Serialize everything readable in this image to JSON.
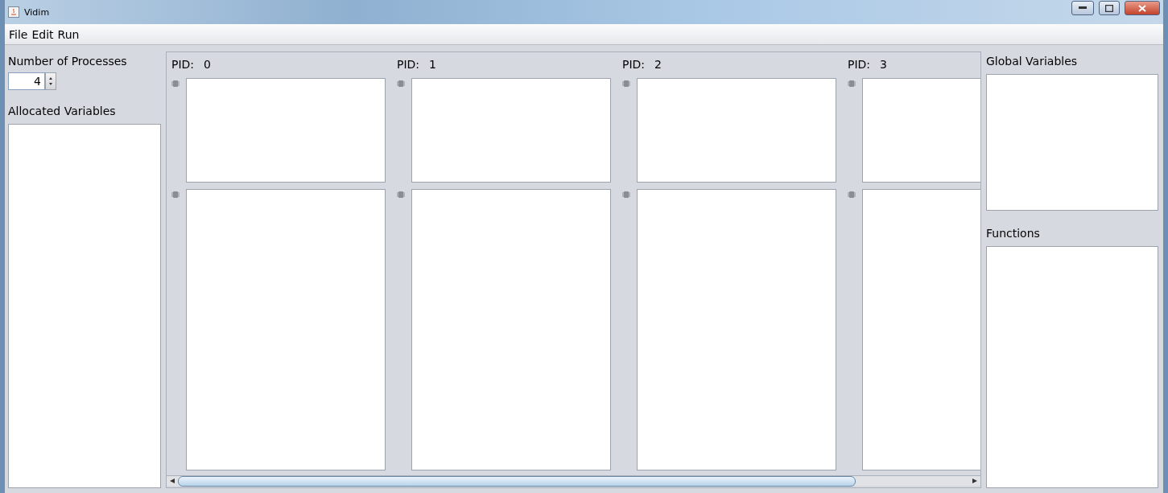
{
  "window": {
    "title": "Vidim"
  },
  "menu": [
    "File",
    "Edit",
    "Run"
  ],
  "left_panel": {
    "processes_label": "Number of Processes",
    "processes_value": "4",
    "allocated_label": "Allocated Variables"
  },
  "processes": [
    {
      "label": "PID:",
      "pid": "0"
    },
    {
      "label": "PID:",
      "pid": "1"
    },
    {
      "label": "PID:",
      "pid": "2"
    },
    {
      "label": "PID:",
      "pid": "3"
    }
  ],
  "right_panel": {
    "globals_label": "Global Variables",
    "functions_label": "Functions"
  }
}
